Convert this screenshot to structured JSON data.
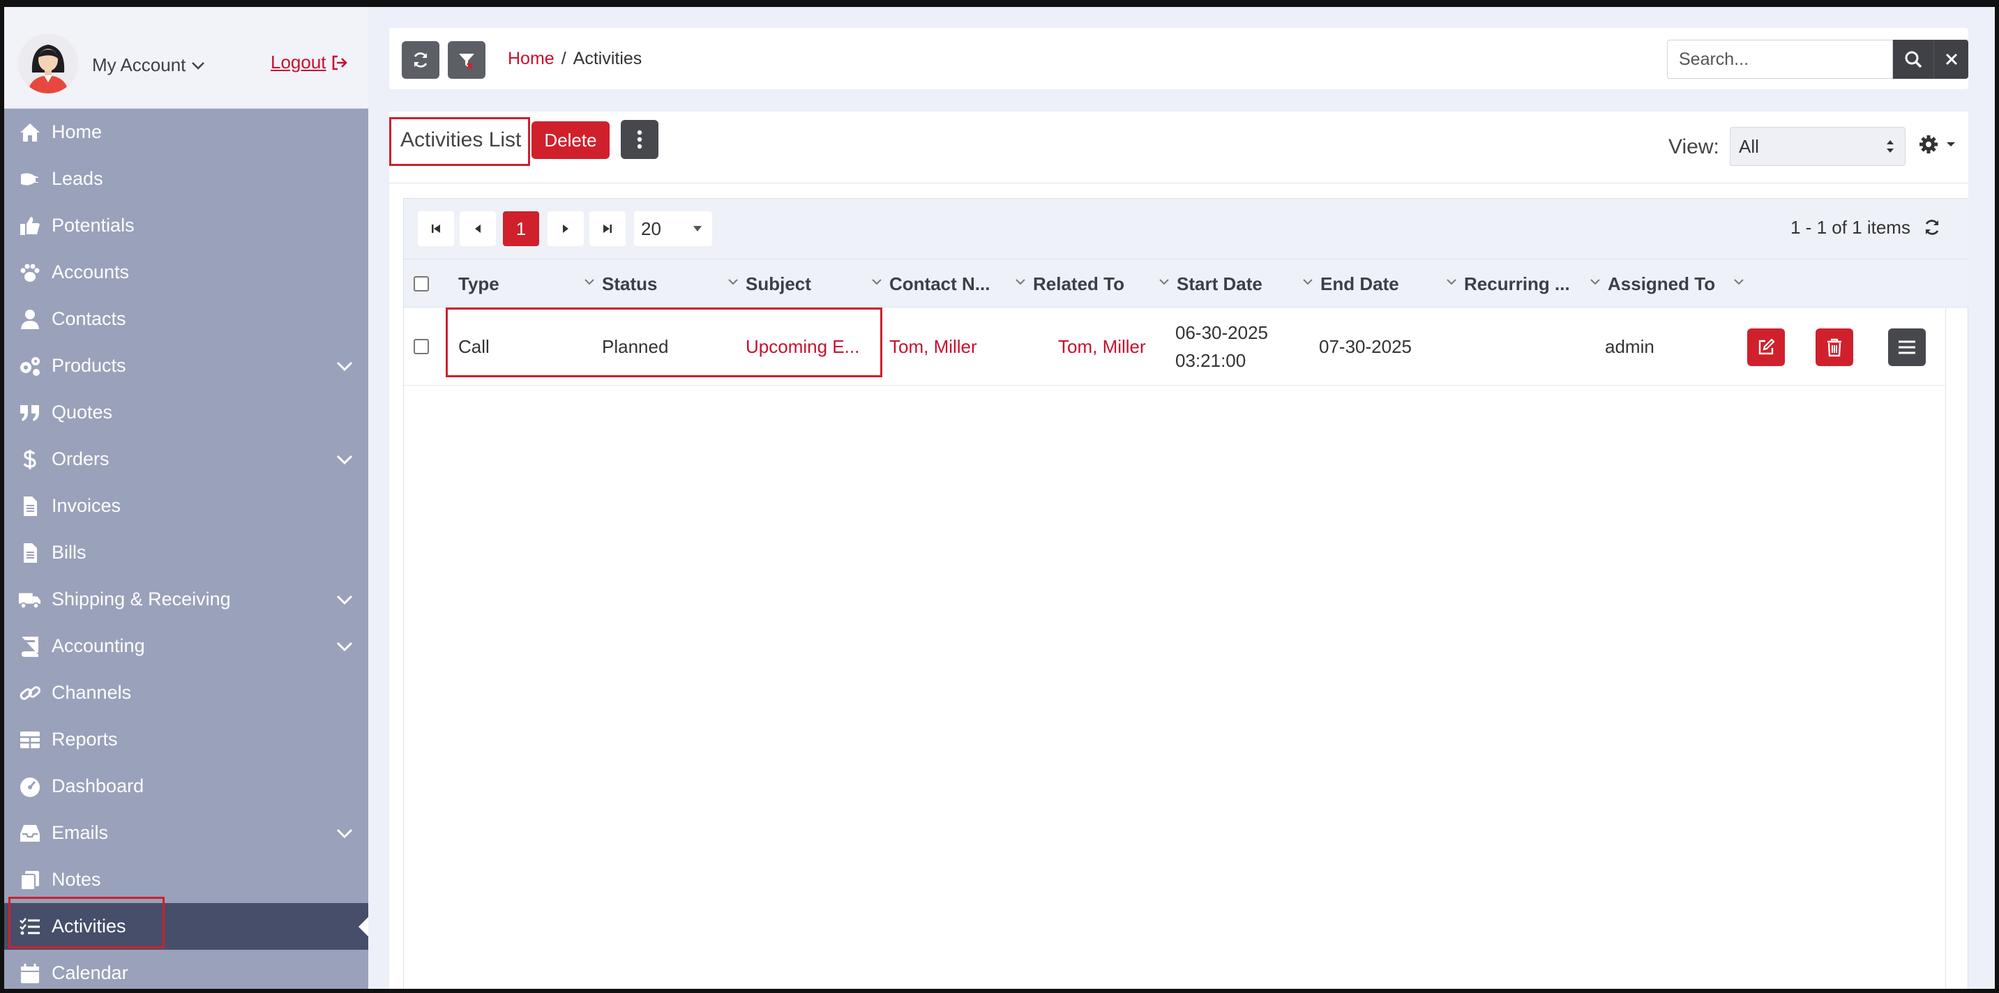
{
  "account": {
    "name": "My Account",
    "logout_label": "Logout"
  },
  "sidebar": {
    "items": [
      {
        "label": "Home",
        "icon": "home-icon"
      },
      {
        "label": "Leads",
        "icon": "leads-icon"
      },
      {
        "label": "Potentials",
        "icon": "thumbs-up-icon"
      },
      {
        "label": "Accounts",
        "icon": "paw-icon"
      },
      {
        "label": "Contacts",
        "icon": "user-icon"
      },
      {
        "label": "Products",
        "icon": "gears-icon",
        "expandable": true
      },
      {
        "label": "Quotes",
        "icon": "quote-icon"
      },
      {
        "label": "Orders",
        "icon": "dollar-icon",
        "expandable": true
      },
      {
        "label": "Invoices",
        "icon": "file-icon"
      },
      {
        "label": "Bills",
        "icon": "file-icon"
      },
      {
        "label": "Shipping & Receiving",
        "icon": "truck-icon",
        "expandable": true
      },
      {
        "label": "Accounting",
        "icon": "book-icon",
        "expandable": true
      },
      {
        "label": "Channels",
        "icon": "link-icon"
      },
      {
        "label": "Reports",
        "icon": "table-icon"
      },
      {
        "label": "Dashboard",
        "icon": "gauge-icon"
      },
      {
        "label": "Emails",
        "icon": "inbox-icon",
        "expandable": true
      },
      {
        "label": "Notes",
        "icon": "notes-icon"
      },
      {
        "label": "Activities",
        "icon": "checklist-icon",
        "active": true
      },
      {
        "label": "Calendar",
        "icon": "calendar-icon"
      }
    ]
  },
  "breadcrumb": {
    "home": "Home",
    "separator": "/",
    "current": "Activities"
  },
  "search": {
    "placeholder": "Search..."
  },
  "list": {
    "title": "Activities List",
    "delete_label": "Delete",
    "view_label": "View:",
    "view_value": "All"
  },
  "pager": {
    "current_page": "1",
    "page_size": "20",
    "items_info": "1 - 1 of 1 items"
  },
  "table": {
    "columns": [
      "Type",
      "Status",
      "Subject",
      "Contact N...",
      "Related To",
      "Start Date",
      "End Date",
      "Recurring ...",
      "Assigned To"
    ],
    "rows": [
      {
        "type": "Call",
        "status": "Planned",
        "subject": "Upcoming E...",
        "contact": "Tom, Miller",
        "related_to": "Tom, Miller",
        "start_date": "06-30-2025",
        "start_time": "03:21:00",
        "end_date": "07-30-2025",
        "recurring": "",
        "assigned_to": "admin"
      }
    ]
  },
  "colors": {
    "accent": "#d0202c",
    "sidebar_bg": "#9aa1ba",
    "sidebar_active": "#464e69",
    "link": "#c8102e"
  }
}
